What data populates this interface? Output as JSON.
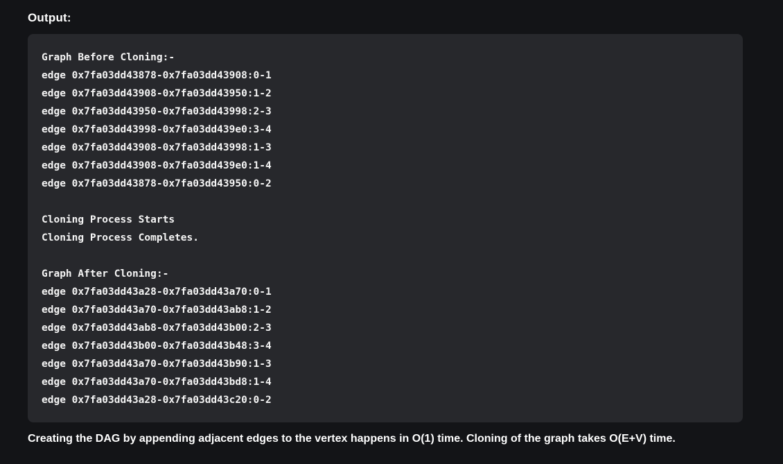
{
  "heading": "Output:",
  "code_lines": [
    "Graph Before Cloning:-",
    "edge 0x7fa03dd43878-0x7fa03dd43908:0-1",
    "edge 0x7fa03dd43908-0x7fa03dd43950:1-2",
    "edge 0x7fa03dd43950-0x7fa03dd43998:2-3",
    "edge 0x7fa03dd43998-0x7fa03dd439e0:3-4",
    "edge 0x7fa03dd43908-0x7fa03dd43998:1-3",
    "edge 0x7fa03dd43908-0x7fa03dd439e0:1-4",
    "edge 0x7fa03dd43878-0x7fa03dd43950:0-2",
    "",
    "Cloning Process Starts",
    "Cloning Process Completes.",
    "",
    "Graph After Cloning:-",
    "edge 0x7fa03dd43a28-0x7fa03dd43a70:0-1",
    "edge 0x7fa03dd43a70-0x7fa03dd43ab8:1-2",
    "edge 0x7fa03dd43ab8-0x7fa03dd43b00:2-3",
    "edge 0x7fa03dd43b00-0x7fa03dd43b48:3-4",
    "edge 0x7fa03dd43a70-0x7fa03dd43b90:1-3",
    "edge 0x7fa03dd43a70-0x7fa03dd43bd8:1-4",
    "edge 0x7fa03dd43a28-0x7fa03dd43c20:0-2"
  ],
  "caption": "Creating the DAG by appending adjacent edges to the vertex happens in O(1) time. Cloning of the graph takes O(E+V) time."
}
